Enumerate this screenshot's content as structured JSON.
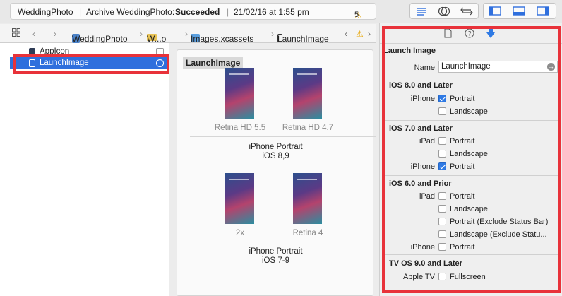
{
  "toolbar": {
    "project": "WeddingPhoto",
    "archive_label": "Archive WeddingPhoto:",
    "archive_status": "Succeeded",
    "timestamp": "21/02/16 at 1:55 pm",
    "warning_count": "5"
  },
  "jumpbar": {
    "crumb1": "WeddingPhoto",
    "crumb2": "W...o",
    "crumb3": "Images.xcassets",
    "crumb4": "LaunchImage"
  },
  "asset_list": {
    "items": [
      {
        "label": "AppIcon"
      },
      {
        "label": "LaunchImage"
      }
    ]
  },
  "asset_detail": {
    "title": "LaunchImage",
    "slots": [
      {
        "label": "Retina HD 5.5"
      },
      {
        "label": "Retina HD 4.7"
      },
      {
        "label": "2x"
      },
      {
        "label": "Retina 4"
      }
    ],
    "group1": {
      "line1": "iPhone Portrait",
      "line2": "iOS 8,9"
    },
    "group2": {
      "line1": "iPhone Portrait",
      "line2": "iOS 7-9"
    }
  },
  "inspector": {
    "section_title": "Launch Image",
    "name_label": "Name",
    "name_value": "LaunchImage",
    "ios8": {
      "title": "iOS 8.0 and Later",
      "device": "iPhone",
      "portrait": "Portrait",
      "landscape": "Landscape"
    },
    "ios7": {
      "title": "iOS 7.0 and Later",
      "ipad": "iPad",
      "portrait": "Portrait",
      "landscape": "Landscape",
      "iphone": "iPhone",
      "iphone_portrait": "Portrait"
    },
    "ios6": {
      "title": "iOS 6.0 and Prior",
      "ipad": "iPad",
      "portrait": "Portrait",
      "landscape": "Landscape",
      "portrait_excl": "Portrait (Exclude Status Bar)",
      "landscape_excl": "Landscape (Exclude Statu...",
      "iphone": "iPhone",
      "iphone_portrait": "Portrait"
    },
    "tvos": {
      "title": "TV OS 9.0 and Later",
      "device": "Apple TV",
      "fullscreen": "Fullscreen"
    }
  },
  "colors": {
    "accent": "#2f6fdd",
    "highlight": "#e8323a",
    "warning": "#e7a400"
  }
}
